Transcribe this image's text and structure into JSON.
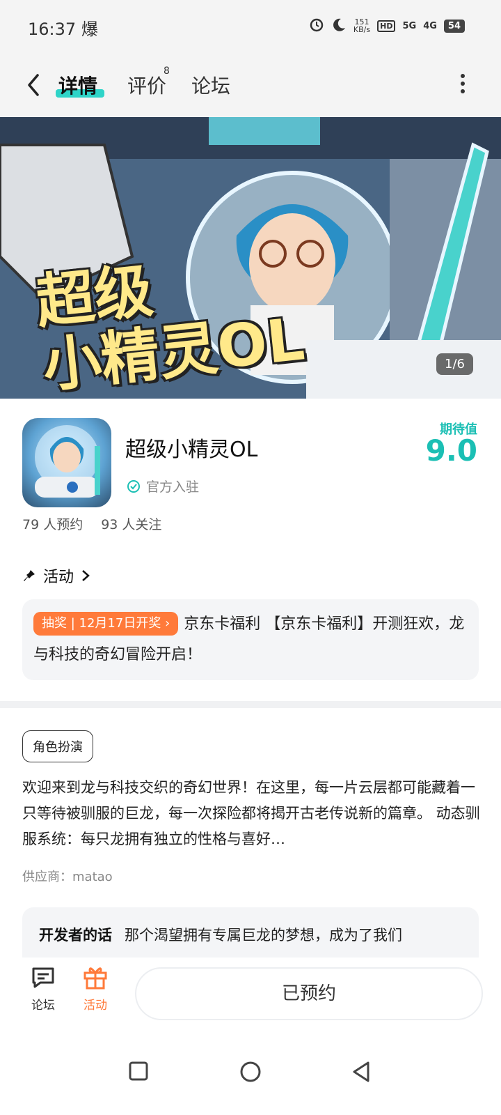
{
  "status_bar": {
    "time": "16:37",
    "notify_char": "爆",
    "speed_value": "151",
    "speed_unit": "KB/s",
    "hd": "HD",
    "net5g": "5G",
    "net4g": "4G",
    "battery": "54"
  },
  "nav": {
    "tabs": [
      {
        "label": "详情"
      },
      {
        "label": "评价"
      },
      {
        "label": "论坛"
      }
    ],
    "review_badge": "8"
  },
  "banner": {
    "title_line1": "超级",
    "title_line2": "小精灵OL",
    "counter": "1/6"
  },
  "app": {
    "name": "超级小精灵OL",
    "verified_label": "官方入驻",
    "expect_label": "期待值",
    "expect_score": "9.0",
    "reservations": "79  人预约",
    "followers": "93  人关注"
  },
  "activity": {
    "heading": "活动",
    "tag": "抽奖 | 12月17日开奖 ›",
    "text": "京东卡福利 【京东卡福利】开测狂欢，龙与科技的奇幻冒险开启！"
  },
  "details": {
    "genre": "角色扮演",
    "description": "欢迎来到龙与科技交织的奇幻世界！在这里，每一片云层都可能藏着一只等待被驯服的巨龙，每一次探险都将揭开古老传说新的篇章。 动态驯服系统：每只龙拥有独立的性格与喜好…",
    "supplier": "供应商：matao"
  },
  "developer": {
    "label": "开发者的话",
    "text": "那个渴望拥有专属巨龙的梦想，成为了我们"
  },
  "bottom_bar": {
    "forum_label": "论坛",
    "activity_label": "活动",
    "reserved_label": "已预约"
  },
  "colors": {
    "accent": "#1bbfb4",
    "tab_underline": "#2fd4c8",
    "orange": "#ff7a3a"
  }
}
